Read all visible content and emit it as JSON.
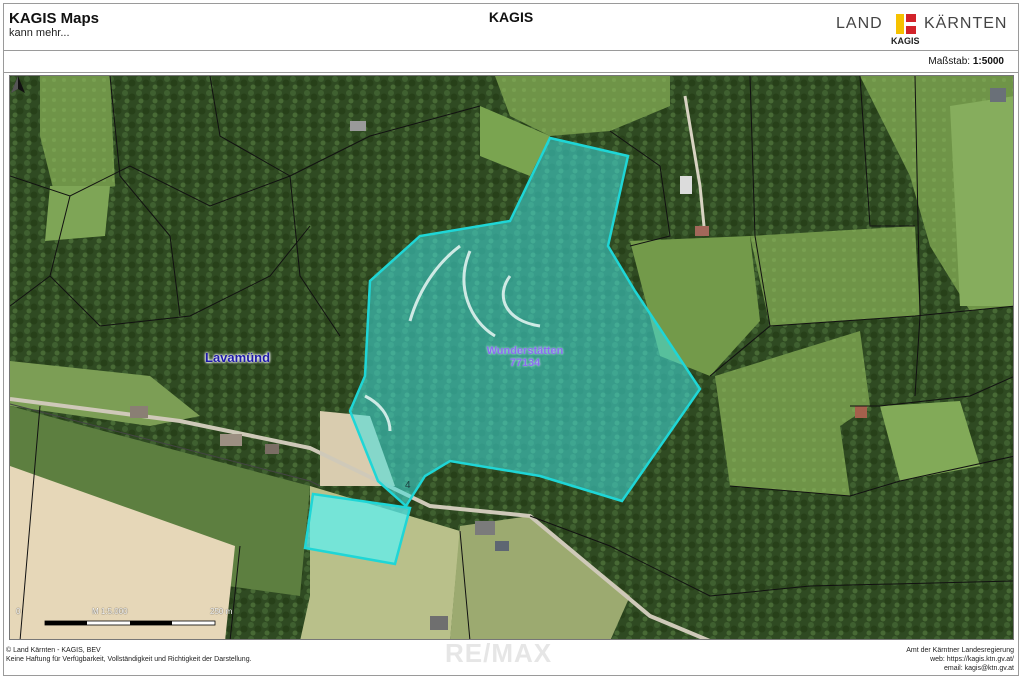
{
  "header": {
    "app_title": "KAGIS Maps",
    "more_link": "kann mehr...",
    "center_title": "KAGIS",
    "logo": {
      "word1": "LAND",
      "word2": "KÄRNTEN",
      "sub": "KAGIS",
      "colors": {
        "red": "#d2232a",
        "yellow": "#f6c200"
      }
    }
  },
  "scale_bar_header": {
    "label": "Maßstab:",
    "value": "1:5000"
  },
  "map": {
    "place_name": "Lavamünd",
    "parcel": {
      "name": "Wunderstätten",
      "number": "77134",
      "fill_color": "#3fe0e0"
    },
    "small_number": "4",
    "scale": {
      "start": "0",
      "ratio": "M 1:5.000",
      "end": "250 m"
    },
    "north_arrow": "north-arrow-icon"
  },
  "footer": {
    "left_line1": "© Land Kärnten - KAGIS, BEV",
    "left_line2": "Keine Haftung für Verfügbarkeit, Vollständigkeit und Richtigkeit der Darstellung.",
    "right_line1": "Amt der Kärntner Landesregierung",
    "right_line2": "web: https://kagis.ktn.gv.at/",
    "right_line3": "email: kagis@ktn.gv.at"
  },
  "watermark": "RE/MAX"
}
